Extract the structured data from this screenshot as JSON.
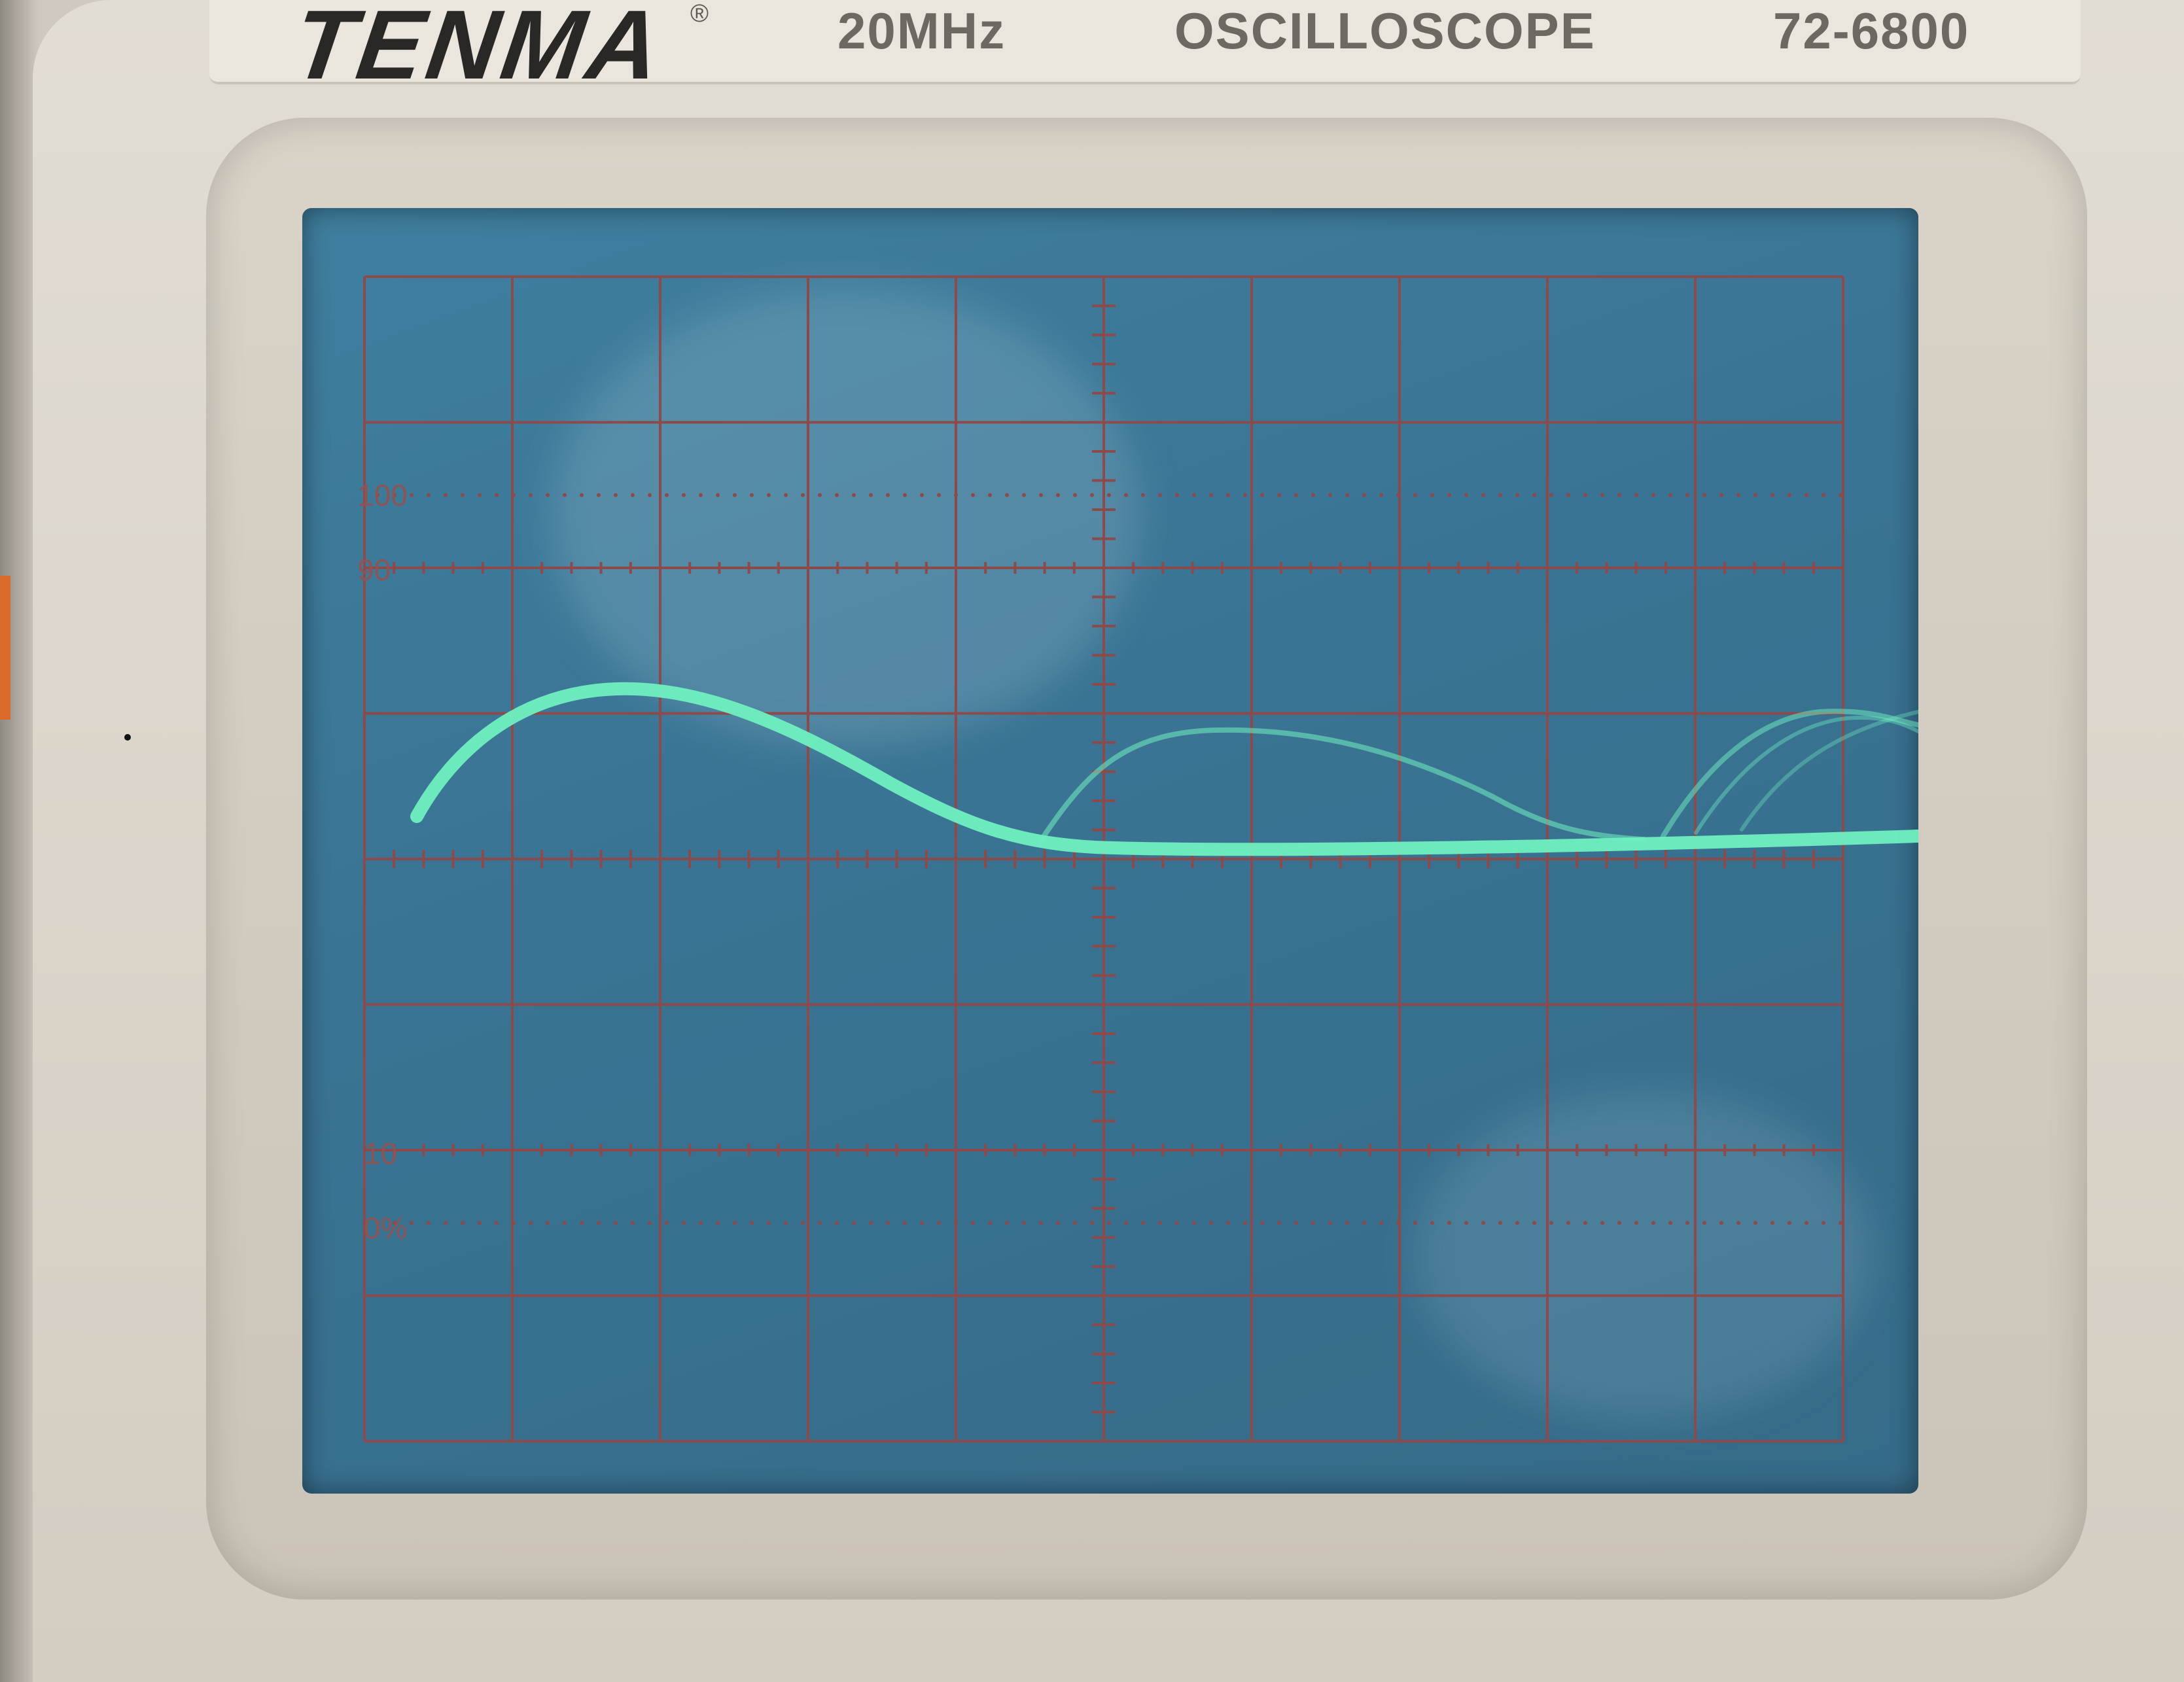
{
  "device": {
    "brand": "TENMA",
    "registered_mark": "®",
    "bandwidth": "20MHz",
    "type": "OSCILLOSCOPE",
    "model": "72-6800"
  },
  "graticule": {
    "marks": {
      "m100": "100",
      "m90": "90",
      "m10": "10",
      "m0": "0%"
    }
  },
  "colors": {
    "trace": "#6ff0c0",
    "screen": "#3a7393",
    "grid": "#8c4a4a"
  }
}
